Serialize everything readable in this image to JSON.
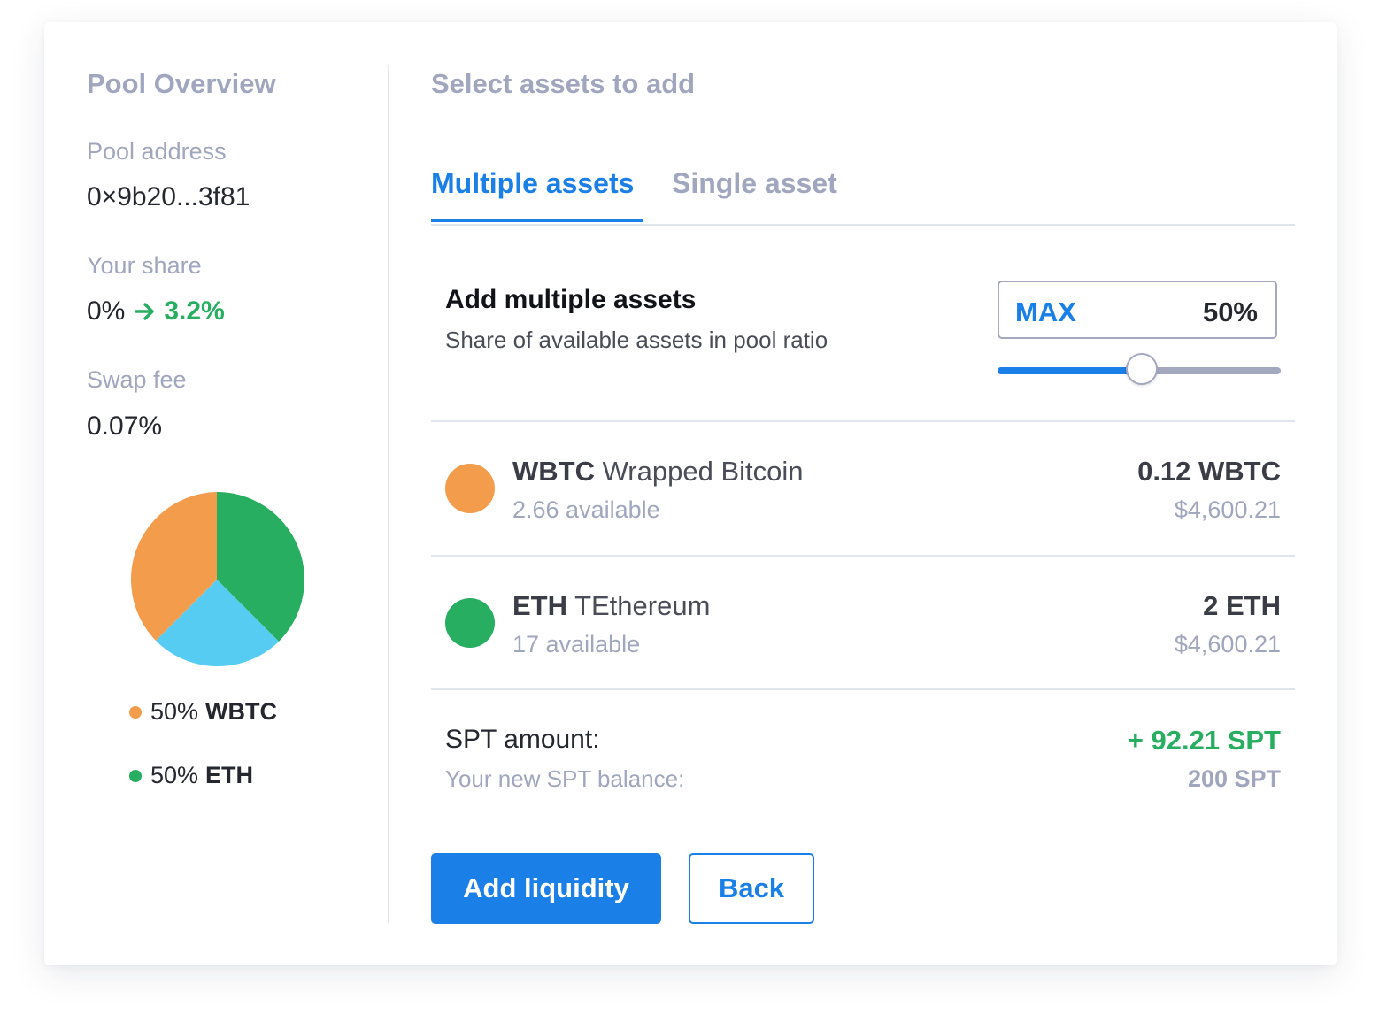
{
  "pool_overview": {
    "title": "Pool Overview",
    "address_label": "Pool address",
    "address_value": "0×9b20...3f81",
    "share_label": "Your share",
    "share_from": "0%",
    "share_to": "3.2%",
    "fee_label": "Swap fee",
    "fee_value": "0.07%",
    "legend": [
      {
        "percent": "50%",
        "symbol": "WBTC",
        "color": "#f29c4c"
      },
      {
        "percent": "50%",
        "symbol": "ETH",
        "color": "#27ae60"
      }
    ],
    "pie_colors": {
      "orange": "#f29c4c",
      "green": "#27ae60",
      "blue": "#56ccf2"
    }
  },
  "select": {
    "title": "Select assets to add",
    "tabs": [
      {
        "label": "Multiple assets",
        "active": true
      },
      {
        "label": "Single asset",
        "active": false
      }
    ],
    "section_title": "Add multiple assets",
    "section_subtitle": "Share of available assets in pool ratio",
    "max_label": "MAX",
    "max_value": "50%",
    "slider_fraction": 0.51
  },
  "assets": [
    {
      "symbol": "WBTC",
      "name": "Wrapped Bitcoin",
      "available": "2.66 available",
      "amount": "0.12 WBTC",
      "usd": "$4,600.21",
      "color": "#f29c4c"
    },
    {
      "symbol": "ETH",
      "name": "TEthereum",
      "available": "17 available",
      "amount": "2 ETH",
      "usd": "$4,600.21",
      "color": "#27ae60"
    }
  ],
  "spt": {
    "label": "SPT amount:",
    "value": "+ 92.21 SPT",
    "balance_label": "Your new SPT balance:",
    "balance_value": "200 SPT"
  },
  "buttons": {
    "primary": "Add liquidity",
    "secondary": "Back"
  },
  "colors": {
    "accent": "#1a7fe6",
    "positive": "#27ae60",
    "muted": "#a0a6bd"
  }
}
